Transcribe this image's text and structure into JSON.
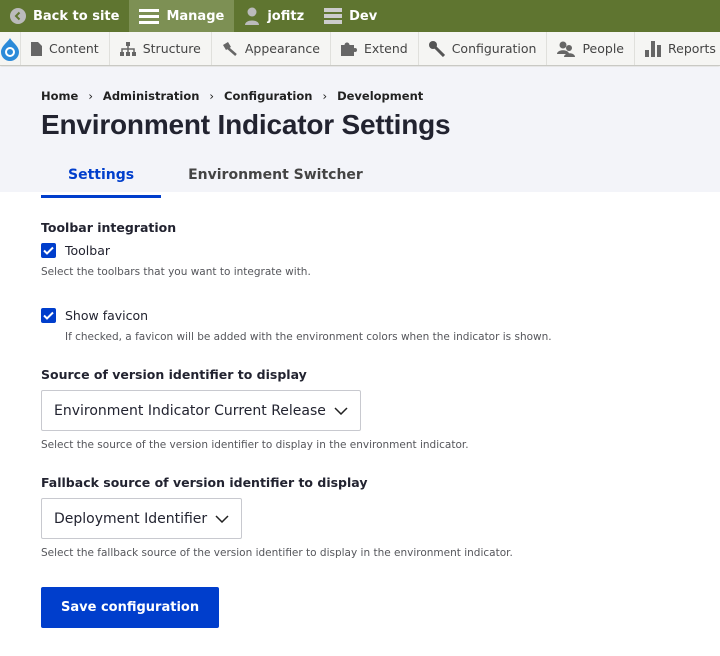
{
  "toolbar": {
    "back": "Back to site",
    "manage": "Manage",
    "user": "jofitz",
    "env": "Dev"
  },
  "menu": [
    "Content",
    "Structure",
    "Appearance",
    "Extend",
    "Configuration",
    "People",
    "Reports"
  ],
  "breadcrumb": [
    "Home",
    "Administration",
    "Configuration",
    "Development"
  ],
  "title": "Environment Indicator Settings",
  "tabs": [
    "Settings",
    "Environment Switcher"
  ],
  "form": {
    "toolbar_heading": "Toolbar integration",
    "toolbar_label": "Toolbar",
    "toolbar_checked": true,
    "toolbar_desc": "Select the toolbars that you want to integrate with.",
    "favicon_label": "Show favicon",
    "favicon_checked": true,
    "favicon_desc": "If checked, a favicon will be added with the environment colors when the indicator is shown.",
    "source_label": "Source of version identifier to display",
    "source_value": "Environment Indicator Current Release",
    "source_desc": "Select the source of the version identifier to display in the environment indicator.",
    "fallback_label": "Fallback source of version identifier to display",
    "fallback_value": "Deployment Identifier",
    "fallback_desc": "Select the fallback source of the version identifier to display in the environment indicator.",
    "save": "Save configuration"
  },
  "colors": {
    "toolbar": "#5f7530",
    "accent": "#003ecc"
  }
}
